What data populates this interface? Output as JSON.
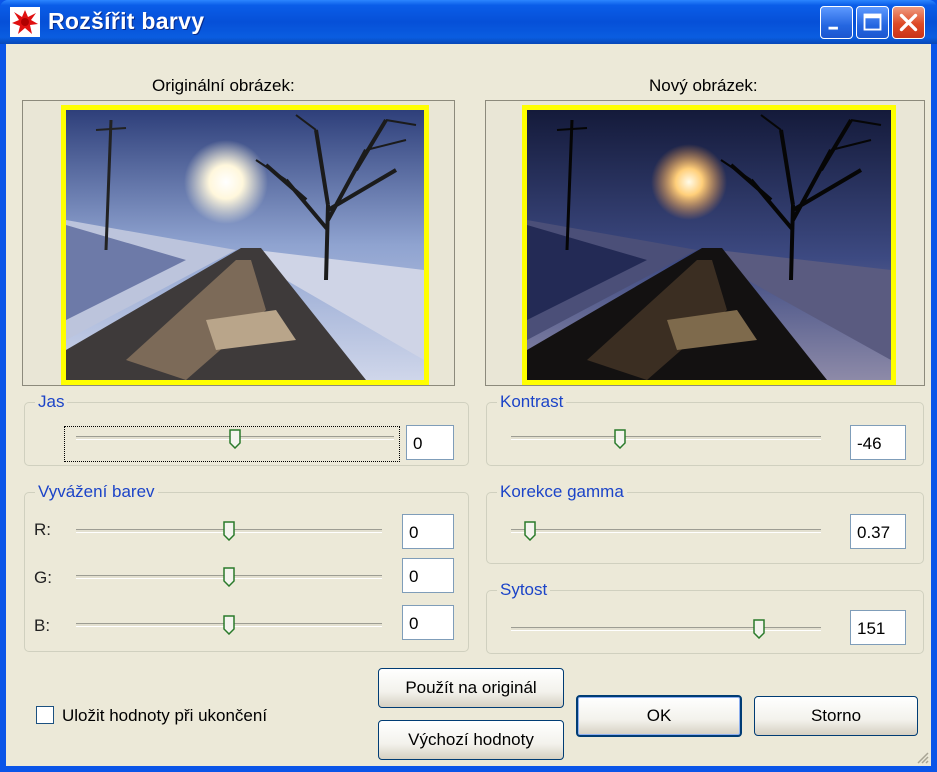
{
  "window": {
    "title": "Rozšířit barvy",
    "app_icon": "paint-splash-icon",
    "controls": [
      "minimize-icon",
      "maximize-icon",
      "close-icon"
    ]
  },
  "original": {
    "caption": "Originální obrázek:"
  },
  "new_image": {
    "caption": "Nový obrázek:"
  },
  "brightness": {
    "title": "Jas",
    "value": "0",
    "level": 0.5
  },
  "contrast": {
    "title": "Kontrast",
    "value": "-46",
    "level": 0.35
  },
  "color_balance": {
    "title": "Vyvážení barev",
    "channels": [
      {
        "label": "R:",
        "value": "0",
        "level": 0.5
      },
      {
        "label": "G:",
        "value": "0",
        "level": 0.5
      },
      {
        "label": "B:",
        "value": "0",
        "level": 0.5
      }
    ]
  },
  "gamma": {
    "title": "Korekce gamma",
    "value": "0.37",
    "level": 0.06
  },
  "saturation": {
    "title": "Sytost",
    "value": "151",
    "level": 0.8
  },
  "save_on_exit": {
    "label": "Uložit hodnoty při ukončení",
    "checked": false
  },
  "buttons": {
    "apply": "Použít na originál",
    "defaults": "Výchozí hodnoty",
    "ok": "OK",
    "cancel": "Storno"
  },
  "colors": {
    "group_title": "#1c44c8",
    "frame_highlight": "#ffff00",
    "titlebar": "#0a55e8"
  }
}
